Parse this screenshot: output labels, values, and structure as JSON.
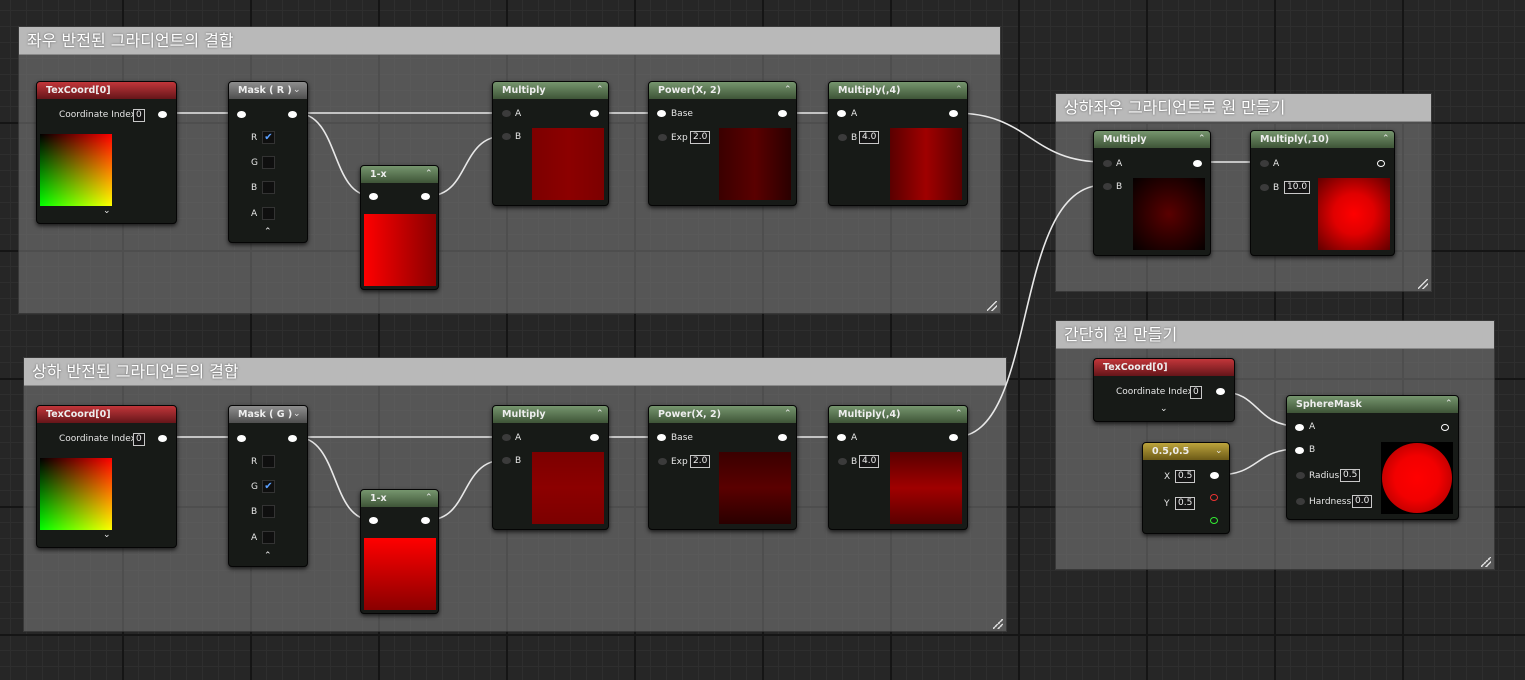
{
  "comments": {
    "top": "좌우 반전된 그라디언트의 결합",
    "bottom": "상하 반전된 그라디언트의 결합",
    "right1": "상하좌우 그라디언트로 원 만들기",
    "right2": "간단히 원 만들기"
  },
  "top_row": {
    "texcoord_title": "TexCoord[0]",
    "texcoord_label": "Coordinate Index",
    "texcoord_value": "0",
    "mask_title": "Mask ( R )",
    "mask_channels": [
      "R",
      "G",
      "B",
      "A"
    ],
    "mask_checked": "R",
    "oneminus_title": "1-x",
    "multiply_title": "Multiply",
    "multiply_a": "A",
    "multiply_b": "B",
    "power_title": "Power(X, 2)",
    "power_base": "Base",
    "power_exp": "Exp",
    "power_exp_value": "2.0",
    "mult4_title": "Multiply(,4)",
    "mult4_a": "A",
    "mult4_b": "B",
    "mult4_value": "4.0"
  },
  "bottom_row": {
    "texcoord_title": "TexCoord[0]",
    "texcoord_label": "Coordinate Index",
    "texcoord_value": "0",
    "mask_title": "Mask ( G )",
    "mask_channels": [
      "R",
      "G",
      "B",
      "A"
    ],
    "mask_checked": "G",
    "oneminus_title": "1-x",
    "multiply_title": "Multiply",
    "multiply_a": "A",
    "multiply_b": "B",
    "power_title": "Power(X, 2)",
    "power_base": "Base",
    "power_exp": "Exp",
    "power_exp_value": "2.0",
    "mult4_title": "Multiply(,4)",
    "mult4_a": "A",
    "mult4_b": "B",
    "mult4_value": "4.0"
  },
  "circle_grad": {
    "multiply_title": "Multiply",
    "a": "A",
    "b": "B",
    "mult10_title": "Multiply(,10)",
    "mult10_a": "A",
    "mult10_b": "B",
    "mult10_value": "10.0"
  },
  "simple_circle": {
    "texcoord_title": "TexCoord[0]",
    "texcoord_label": "Coordinate Index",
    "texcoord_value": "0",
    "const_title": "0.5,0.5",
    "x_label": "X",
    "x_value": "0.5",
    "y_label": "Y",
    "y_value": "0.5",
    "sphere_title": "SphereMask",
    "a": "A",
    "b": "B",
    "radius_label": "Radius",
    "radius_value": "0.5",
    "hardness_label": "Hardness",
    "hardness_value": "0.0"
  },
  "icons": {
    "chevron_up": "⌃",
    "chevron_down": "⌄",
    "check": "✔"
  },
  "colors": {
    "node_header_green": "#5a7a52",
    "node_header_red": "#a0262b",
    "wire": "#e8e8e8",
    "comment_title": "#b9b9b9"
  }
}
